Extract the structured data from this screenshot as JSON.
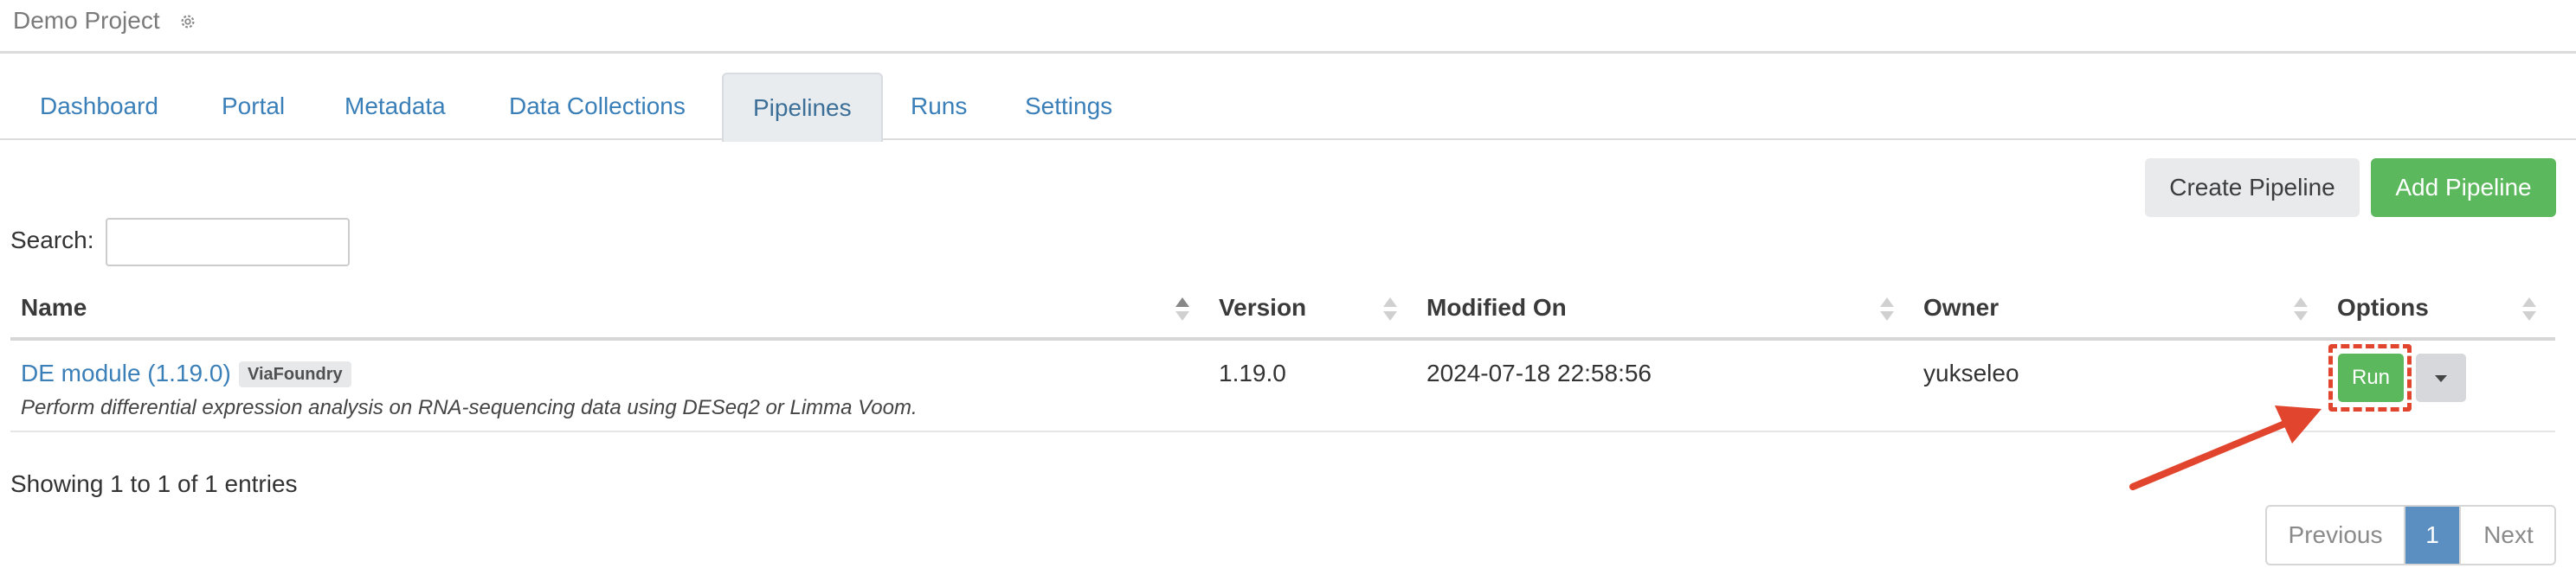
{
  "project": {
    "title": "Demo Project",
    "settings_icon": "gear-icon"
  },
  "tabs": [
    {
      "label": "Dashboard",
      "active": false
    },
    {
      "label": "Portal",
      "active": false
    },
    {
      "label": "Metadata",
      "active": false
    },
    {
      "label": "Data Collections",
      "active": false
    },
    {
      "label": "Pipelines",
      "active": true
    },
    {
      "label": "Runs",
      "active": false
    },
    {
      "label": "Settings",
      "active": false
    }
  ],
  "toolbar": {
    "create_label": "Create Pipeline",
    "add_label": "Add Pipeline"
  },
  "search": {
    "label": "Search:",
    "value": "",
    "placeholder": ""
  },
  "table": {
    "columns": [
      "Name",
      "Version",
      "Modified On",
      "Owner",
      "Options"
    ],
    "sorted_column": "Name",
    "sort_direction": "asc",
    "rows": [
      {
        "name": "DE module (1.19.0)",
        "badge": "ViaFoundry",
        "description": "Perform differential expression analysis on RNA-sequencing data using DESeq2 or Limma Voom.",
        "version": "1.19.0",
        "modified_on": "2024-07-18 22:58:56",
        "owner": "yukseleo",
        "run_label": "Run",
        "dropdown_icon": "caret-down-icon"
      }
    ]
  },
  "summary": "Showing 1 to 1 of 1 entries",
  "pagination": {
    "previous": "Previous",
    "current": "1",
    "next": "Next"
  },
  "annotation": {
    "highlight_color": "#e2452d",
    "arrow_color": "#e2452d"
  },
  "colors": {
    "link": "#3a7fb8",
    "success": "#5cb85c",
    "page_active": "#5b8ec1"
  }
}
